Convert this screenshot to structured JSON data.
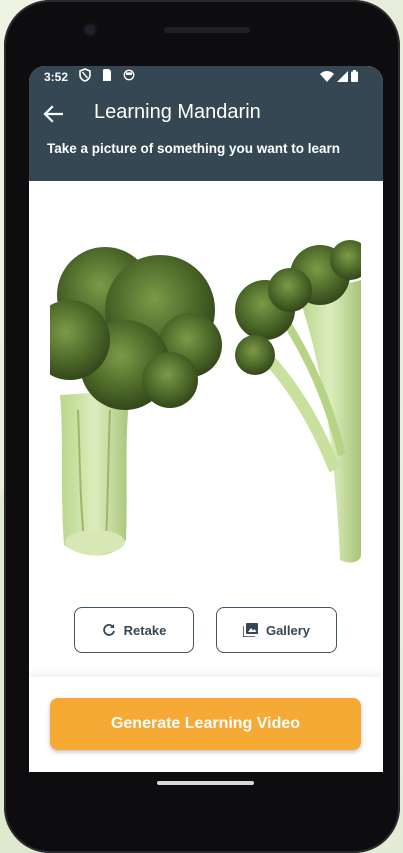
{
  "status_bar": {
    "time": "3:52",
    "left_icons": [
      "shield-icon",
      "sim-card-icon",
      "app-status-icon"
    ],
    "right_icons": [
      "wifi-icon",
      "cell-signal-icon",
      "battery-icon"
    ]
  },
  "header": {
    "title": "Learning Mandarin",
    "subtitle": "Take a picture of something you want to learn",
    "background_color": "#354753"
  },
  "photo": {
    "subject": "broccoli",
    "icon": "broccoli-photo"
  },
  "actions": {
    "retake_label": "Retake",
    "retake_icon": "refresh-icon",
    "gallery_label": "Gallery",
    "gallery_icon": "image-gallery-icon"
  },
  "primary_action": {
    "label": "Generate Learning Video",
    "color": "#f6a934"
  }
}
